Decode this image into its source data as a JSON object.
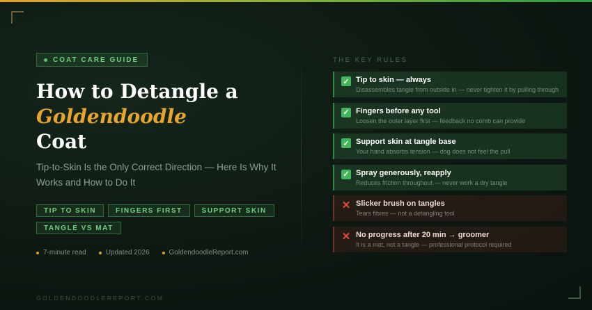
{
  "badge": {
    "label": "COAT CARE GUIDE"
  },
  "title": {
    "line1": "How to Detangle a",
    "accent": "Goldendoodle",
    "line3": "Coat"
  },
  "subtitle": "Tip-to-Skin Is the Only Correct Direction — Here Is Why It Works and How to Do It",
  "tags": [
    "TIP TO SKIN",
    "FINGERS FIRST",
    "SUPPORT SKIN",
    "TANGLE VS MAT"
  ],
  "meta": [
    "7-minute read",
    "Updated 2026",
    "GoldendoodleReport.com"
  ],
  "footer": "GOLDENDOODLEREPORT.COM",
  "rules_heading": "THE KEY RULES",
  "rules": [
    {
      "kind": "good",
      "icon": "check-icon",
      "title": "Tip to skin — always",
      "desc": "Disassembles tangle from outside in — never tighten it by pulling through"
    },
    {
      "kind": "good",
      "icon": "check-icon",
      "title": "Fingers before any tool",
      "desc": "Loosen the outer layer first — feedback no comb can provide"
    },
    {
      "kind": "good",
      "icon": "check-icon",
      "title": "Support skin at tangle base",
      "desc": "Your hand absorbs tension — dog does not feel the pull"
    },
    {
      "kind": "good",
      "icon": "check-icon",
      "title": "Spray generously, reapply",
      "desc": "Reduces friction throughout — never work a dry tangle"
    },
    {
      "kind": "bad",
      "icon": "cross-icon",
      "title": "Slicker brush on tangles",
      "desc": "Tears fibres — not a detangling tool"
    },
    {
      "kind": "bad",
      "icon": "cross-icon",
      "title": "No progress after 20 min → groomer",
      "desc": "It is a mat, not a tangle — professional protocol required"
    }
  ],
  "colors": {
    "accent": "#e8a52c",
    "green": "#6fcf7f",
    "good_border": "#2e8a45",
    "bad_icon": "#e84a3b"
  }
}
